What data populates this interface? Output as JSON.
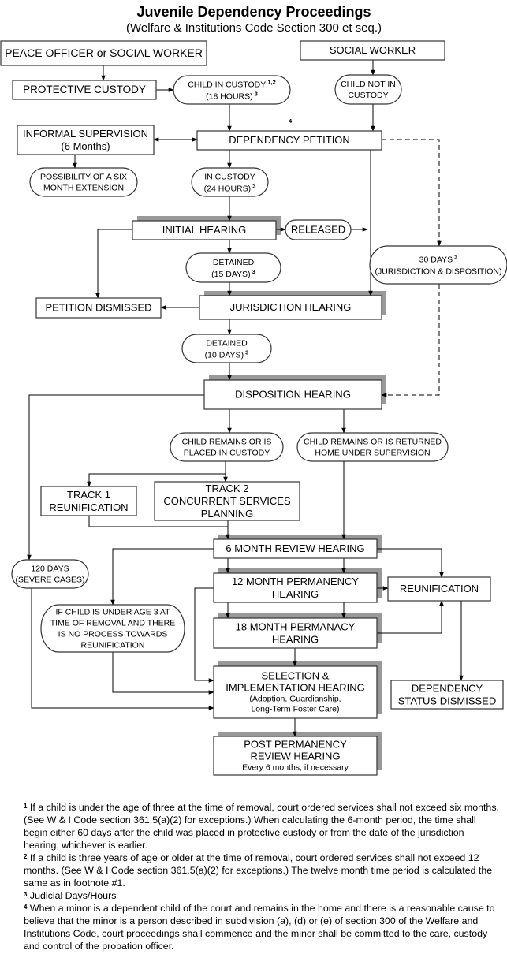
{
  "header": {
    "title": "Juvenile Dependency Proceedings",
    "subtitle": "(Welfare & Institutions Code Section 300 et seq.)"
  },
  "nodes": {
    "peace_officer": {
      "lines": [
        "PEACE OFFICER or SOCIAL WORKER"
      ]
    },
    "social_worker": {
      "lines": [
        "SOCIAL WORKER"
      ]
    },
    "protective_custody": {
      "lines": [
        "PROTECTIVE CUSTODY"
      ]
    },
    "child_in_custody": {
      "lines": [
        "CHILD IN CUSTODY",
        "(18 HOURS)"
      ],
      "sups": [
        "1,2",
        "3"
      ]
    },
    "child_not_in_custody": {
      "lines": [
        "CHILD NOT IN",
        "CUSTODY"
      ]
    },
    "petition_footnote": {
      "lines": [
        "4"
      ]
    },
    "informal_supervision": {
      "lines": [
        "INFORMAL SUPERVISION",
        "(6 Months)"
      ]
    },
    "dependency_petition": {
      "lines": [
        "DEPENDENCY PETITION"
      ]
    },
    "six_month_extension": {
      "lines": [
        "POSSIBILITY OF A SIX",
        "MONTH EXTENSION"
      ]
    },
    "in_custody_24": {
      "lines": [
        "IN CUSTODY",
        "(24 HOURS)"
      ],
      "sups": [
        "",
        "3"
      ]
    },
    "initial_hearing": {
      "lines": [
        "INITIAL HEARING"
      ]
    },
    "released": {
      "lines": [
        "RELEASED"
      ]
    },
    "thirty_days": {
      "lines": [
        "30 DAYS",
        "(JURISDICTION & DISPOSITION)"
      ],
      "sups": [
        "3",
        ""
      ]
    },
    "detained_15": {
      "lines": [
        "DETAINED",
        "(15 DAYS)"
      ],
      "sups": [
        "",
        "3"
      ]
    },
    "petition_dismissed": {
      "lines": [
        "PETITION DISMISSED"
      ]
    },
    "jurisdiction_hearing": {
      "lines": [
        "JURISDICTION HEARING"
      ]
    },
    "detained_10": {
      "lines": [
        "DETAINED",
        "(10 DAYS)"
      ],
      "sups": [
        "",
        "3"
      ]
    },
    "disposition_hearing": {
      "lines": [
        "DISPOSITION HEARING"
      ]
    },
    "child_placed_custody": {
      "lines": [
        "CHILD REMAINS OR IS",
        "PLACED IN CUSTODY"
      ]
    },
    "child_returned_home": {
      "lines": [
        "CHILD REMAINS OR IS RETURNED",
        "HOME UNDER SUPERVISION"
      ]
    },
    "track1": {
      "lines": [
        "TRACK 1",
        "REUNIFICATION"
      ]
    },
    "track2": {
      "lines": [
        "TRACK 2",
        "CONCURRENT SERVICES",
        "PLANNING"
      ]
    },
    "six_month_review": {
      "lines": [
        "6 MONTH REVIEW HEARING"
      ]
    },
    "one_twenty_days": {
      "lines": [
        "120 DAYS",
        "(SEVERE CASES)"
      ]
    },
    "twelve_month": {
      "lines": [
        "12 MONTH PERMANENCY",
        "HEARING"
      ]
    },
    "reunification": {
      "lines": [
        "REUNIFICATION"
      ]
    },
    "under_age_3": {
      "lines": [
        "IF CHILD IS UNDER AGE 3 AT",
        "TIME OF REMOVAL AND THERE",
        "IS NO PROCESS TOWARDS",
        "REUNIFICATION"
      ]
    },
    "eighteen_month": {
      "lines": [
        "18 MONTH PERMANACY",
        "HEARING"
      ]
    },
    "selection": {
      "lines": [
        "SELECTION &",
        "IMPLEMENTATION HEARING",
        "(Adoption, Guardianship,",
        "Long-Term Foster Care)"
      ]
    },
    "dependency_dismissed": {
      "lines": [
        "DEPENDENCY",
        "STATUS DISMISSED"
      ]
    },
    "post_permanency": {
      "lines": [
        "POST PERMANENCY",
        "REVIEW HEARING",
        "Every 6 months, if necessary"
      ]
    }
  },
  "footnotes": [
    {
      "mark": "1",
      "text": "If a child is under the age of three at the time of removal, court ordered services shall not exceed six months. (See W & I Code section 361.5(a)(2) for exceptions.) When calculating the 6-month period, the time shall begin either 60 days after the child was placed in protective custody or from the date of the jurisdiction hearing, whichever is earlier."
    },
    {
      "mark": "2",
      "text": "If a child is three years of age or older at the time of removal, court ordered services shall not exceed 12 months. (See W & I Code section 361.5(a)(2) for exceptions.) The twelve month time period is calculated the same as in footnote #1."
    },
    {
      "mark": "3",
      "text": "Judicial Days/Hours"
    },
    {
      "mark": "4",
      "text": "When a minor is a dependent child of the court and remains in the home and there is a reasonable cause to believe that the minor is a person described in subdivision (a), (d) or (e) of section 300 of the Welfare and Institutions Code, court proceedings shall commence and the minor shall be committed to the care, custody and control of the probation officer."
    }
  ],
  "colors": {
    "shadow": "#999999",
    "line": "#000000",
    "border": "#333333"
  }
}
